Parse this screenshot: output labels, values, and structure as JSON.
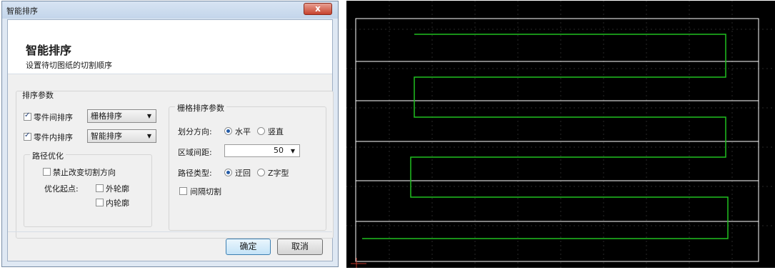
{
  "window": {
    "title": "智能排序",
    "close_label": "x"
  },
  "header": {
    "title": "智能排序",
    "subtitle": "设置待切图纸的切割顺序"
  },
  "sort_params": {
    "group_title": "排序参数",
    "inter_part": {
      "label": "零件间排序",
      "checked": true,
      "value": "栅格排序"
    },
    "intra_part": {
      "label": "零件内排序",
      "checked": true,
      "value": "智能排序"
    },
    "path_opt": {
      "title": "路径优化",
      "no_change_dir": {
        "label": "禁止改变切割方向",
        "checked": false
      },
      "start_label": "优化起点:",
      "outer": {
        "label": "外轮廓",
        "checked": false
      },
      "inner": {
        "label": "内轮廓",
        "checked": false
      }
    }
  },
  "grid_params": {
    "title": "栅格排序参数",
    "divide_label": "划分方向:",
    "horizontal": "水平",
    "vertical": "竖直",
    "divide_selected": "horizontal",
    "spacing_label": "区域间距:",
    "spacing_value": "50",
    "path_type_label": "路径类型:",
    "zigzag": "迂回",
    "ztype": "Z字型",
    "path_selected": "zigzag",
    "interval_cut": {
      "label": "间隔切割",
      "checked": false
    }
  },
  "buttons": {
    "ok": "确定",
    "cancel": "取消"
  },
  "canvas": {
    "background": "#000000",
    "path_color": "#20c020",
    "grid_color": "#ffffff"
  }
}
